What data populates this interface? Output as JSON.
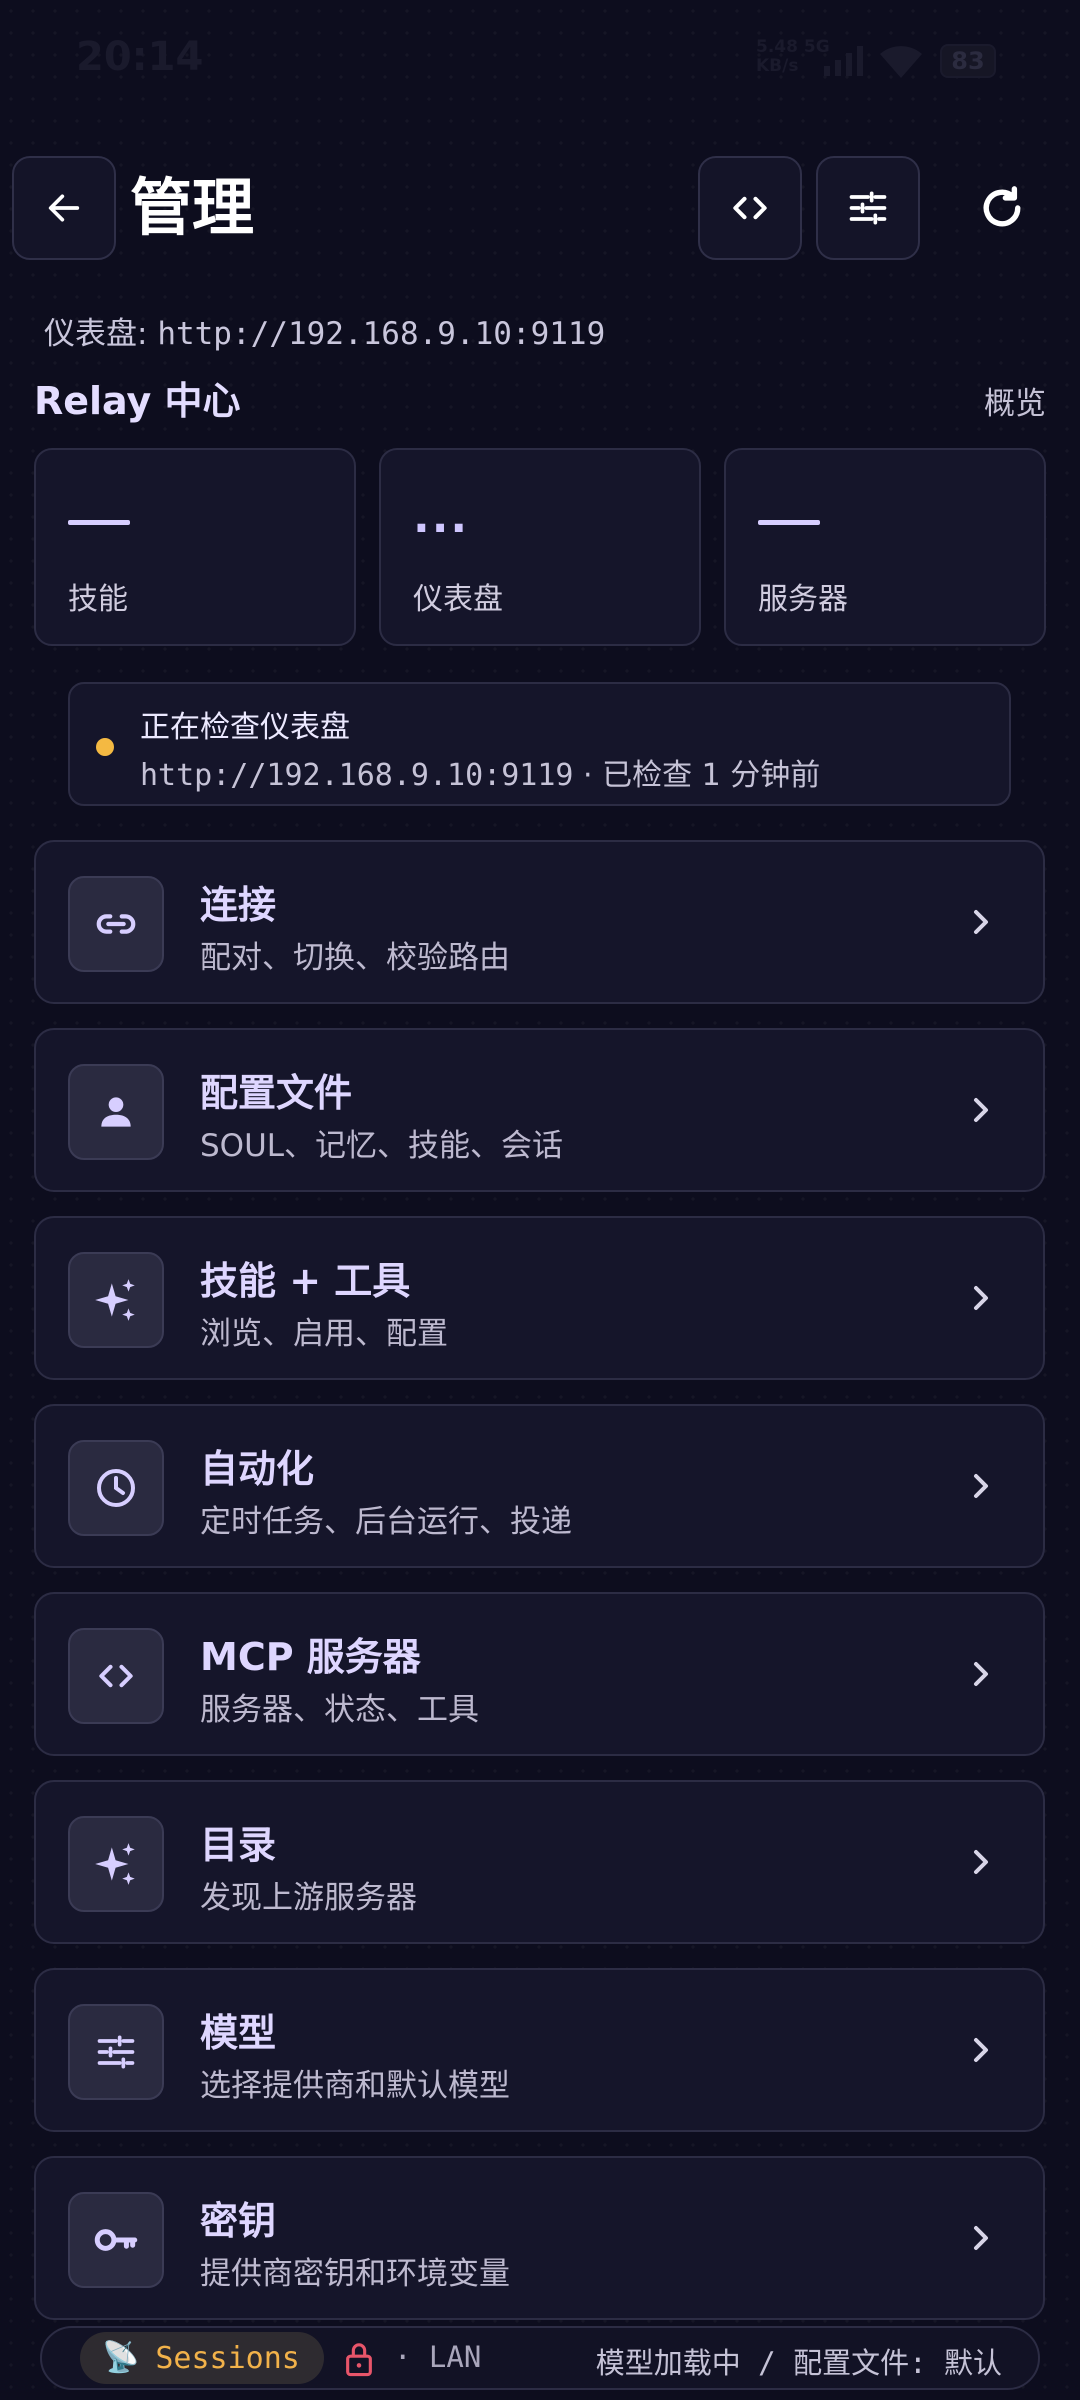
{
  "status_bar": {
    "time": "20:14",
    "network_speed": "5.48",
    "network_speed_unit": "KB/s",
    "network_type": "5G",
    "battery": "83"
  },
  "header": {
    "title": "管理",
    "icons": {
      "back": "arrow-left-icon",
      "code": "code-icon",
      "tune": "tune-icon",
      "refresh": "refresh-icon"
    }
  },
  "dashboard": {
    "label": "仪表盘:",
    "url": "http://192.168.9.10:9119"
  },
  "relay": {
    "title": "Relay 中心",
    "overview_link": "概览",
    "stats": [
      {
        "value": "—",
        "label": "技能"
      },
      {
        "value": "...",
        "label": "仪表盘"
      },
      {
        "value": "—",
        "label": "服务器"
      }
    ]
  },
  "check_banner": {
    "status_color": "#f4b942",
    "title": "正在检查仪表盘",
    "url": "http://192.168.9.10:9119",
    "separator": "·",
    "checked_text": "已检查 1 分钟前"
  },
  "menu": [
    {
      "icon": "link-icon",
      "title": "连接",
      "subtitle": "配对、切换、校验路由"
    },
    {
      "icon": "person-icon",
      "title": "配置文件",
      "subtitle": "SOUL、记忆、技能、会话"
    },
    {
      "icon": "sparkle-icon",
      "title": "技能 + 工具",
      "subtitle": "浏览、启用、配置"
    },
    {
      "icon": "clock-icon",
      "title": "自动化",
      "subtitle": "定时任务、后台运行、投递"
    },
    {
      "icon": "code-icon",
      "title": "MCP 服务器",
      "subtitle": "服务器、状态、工具"
    },
    {
      "icon": "sparkle-icon",
      "title": "目录",
      "subtitle": "发现上游服务器"
    },
    {
      "icon": "tune-icon",
      "title": "模型",
      "subtitle": "选择提供商和默认模型"
    },
    {
      "icon": "key-icon",
      "title": "密钥",
      "subtitle": "提供商密钥和环境变量"
    }
  ],
  "bottom_bar": {
    "sessions_emoji": "📡",
    "sessions_label": "Sessions",
    "lan_label": "· LAN",
    "status_text": "模型加载中 / 配置文件: 默认",
    "accent": "#f2b24a",
    "lock_color": "#e8556a"
  },
  "colors": {
    "background": "#0d0d1e",
    "card": "#15152a",
    "accent": "#cfc6ff"
  }
}
